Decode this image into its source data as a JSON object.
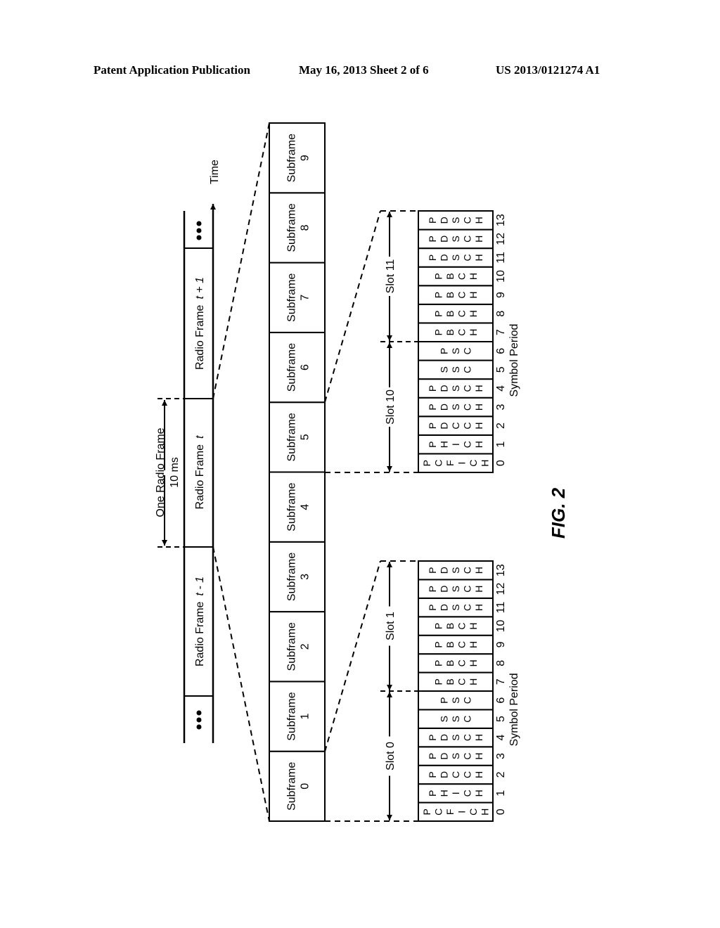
{
  "header": {
    "publication": "Patent Application Publication",
    "date_sheet": "May 16, 2013  Sheet 2 of 6",
    "number": "US 2013/0121274 A1"
  },
  "figure": {
    "label": "FIG. 2",
    "time_label": "Time",
    "ellipsis": "•••",
    "one_radio_frame": "One Radio Frame",
    "frame_duration": "10 ms",
    "radio_frames": [
      {
        "name": "Radio Frame",
        "index": "t + 1"
      },
      {
        "name": "Radio Frame",
        "index": "t"
      },
      {
        "name": "Radio Frame",
        "index": "t - 1"
      }
    ],
    "subframe_word": "Subframe",
    "subframes": [
      "0",
      "1",
      "2",
      "3",
      "4",
      "5",
      "6",
      "7",
      "8",
      "9"
    ],
    "symbol_period_label": "Symbol Period",
    "slot_groups": [
      {
        "name": "upper",
        "slots": [
          "Slot 10",
          "Slot 11"
        ],
        "symbols": [
          {
            "index": "0",
            "channel": "PCFICH"
          },
          {
            "index": "1",
            "channel": "PHICH"
          },
          {
            "index": "2",
            "channel": "PDCCH"
          },
          {
            "index": "3",
            "channel": "PDSCH"
          },
          {
            "index": "4",
            "channel": "PDSCH"
          },
          {
            "index": "5",
            "channel": "SSC"
          },
          {
            "index": "6",
            "channel": "PSC"
          },
          {
            "index": "7",
            "channel": "PBCH"
          },
          {
            "index": "8",
            "channel": "PBCH"
          },
          {
            "index": "9",
            "channel": "PBCH"
          },
          {
            "index": "10",
            "channel": "PBCH"
          },
          {
            "index": "11",
            "channel": "PDSCH"
          },
          {
            "index": "12",
            "channel": "PDSCH"
          },
          {
            "index": "13",
            "channel": "PDSCH"
          }
        ]
      },
      {
        "name": "lower",
        "slots": [
          "Slot 0",
          "Slot 1"
        ],
        "symbols": [
          {
            "index": "0",
            "channel": "PCFICH"
          },
          {
            "index": "1",
            "channel": "PHICH"
          },
          {
            "index": "2",
            "channel": "PDCCH"
          },
          {
            "index": "3",
            "channel": "PDSCH"
          },
          {
            "index": "4",
            "channel": "PDSCH"
          },
          {
            "index": "5",
            "channel": "SSC"
          },
          {
            "index": "6",
            "channel": "PSC"
          },
          {
            "index": "7",
            "channel": "PBCH"
          },
          {
            "index": "8",
            "channel": "PBCH"
          },
          {
            "index": "9",
            "channel": "PBCH"
          },
          {
            "index": "10",
            "channel": "PBCH"
          },
          {
            "index": "11",
            "channel": "PDSCH"
          },
          {
            "index": "12",
            "channel": "PDSCH"
          },
          {
            "index": "13",
            "channel": "PDSCH"
          }
        ]
      }
    ]
  }
}
